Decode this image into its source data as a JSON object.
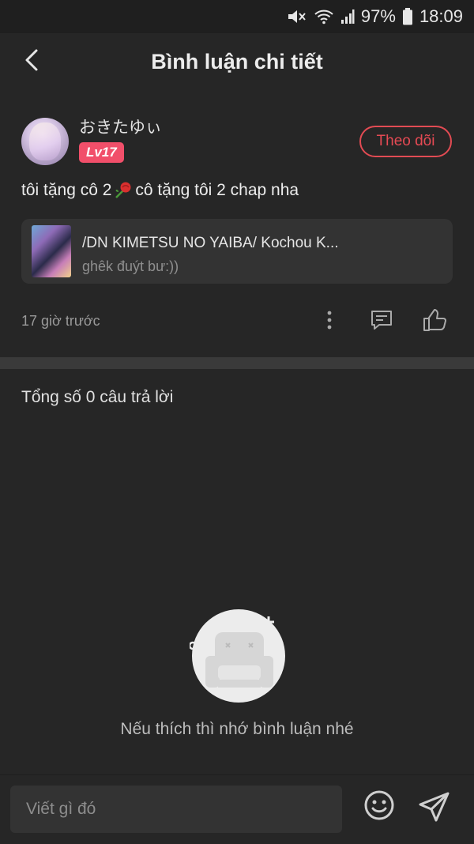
{
  "status_bar": {
    "battery": "97%",
    "time": "18:09",
    "icons": [
      "mute-icon",
      "wifi-icon",
      "signal-icon",
      "battery-icon"
    ]
  },
  "header": {
    "title": "Bình luận chi tiết",
    "back_icon": "chevron-left-icon"
  },
  "comment": {
    "username": "おきたゆぃ",
    "level": "Lv17",
    "follow_label": "Theo dõi",
    "text_before": "tôi tặng cô 2",
    "text_after": " cô tặng tôi 2 chap nha",
    "story": {
      "title": "/DN KIMETSU NO YAIBA/ Kochou K...",
      "subtitle": "ghêk đuýt bư:))"
    },
    "time": "17 giờ trước",
    "actions": [
      "more-vertical-icon",
      "comment-icon",
      "like-icon"
    ]
  },
  "replies": {
    "total_label": "Tổng số 0 câu trả lời",
    "empty_text": "Nếu thích thì nhớ bình luận nhé"
  },
  "composer": {
    "placeholder": "Viết gì đó"
  },
  "colors": {
    "background": "#262626",
    "accent": "#e64a54",
    "level_badge": "#f14f6a"
  }
}
